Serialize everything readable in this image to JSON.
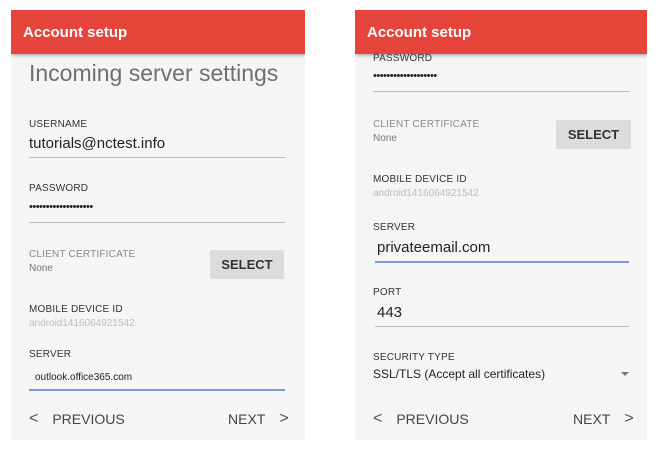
{
  "left": {
    "app_title": "Account setup",
    "heading": "Incoming server settings",
    "username": {
      "label": "USERNAME",
      "value": "tutorials@nctest.info"
    },
    "password": {
      "label": "PASSWORD",
      "value": "•••••••••••••••••••"
    },
    "client_certificate": {
      "label": "CLIENT CERTIFICATE",
      "value": "None",
      "button": "SELECT"
    },
    "mobile_device_id": {
      "label": "MOBILE DEVICE ID",
      "value": "android1416064921542"
    },
    "server": {
      "label": "SERVER",
      "value": "outlook.office365.com"
    },
    "footer": {
      "prev_chev": "<",
      "previous": "PREVIOUS",
      "next": "NEXT",
      "next_chev": ">"
    }
  },
  "right": {
    "app_title": "Account setup",
    "password": {
      "label": "PASSWORD",
      "value": "•••••••••••••••••••"
    },
    "client_certificate": {
      "label": "CLIENT CERTIFICATE",
      "value": "None",
      "button": "SELECT"
    },
    "mobile_device_id": {
      "label": "MOBILE DEVICE ID",
      "value": "android1416064921542"
    },
    "server": {
      "label": "SERVER",
      "value": "privateemail.com"
    },
    "port": {
      "label": "PORT",
      "value": "443"
    },
    "security_type": {
      "label": "SECURITY TYPE",
      "value": "SSL/TLS (Accept all certificates)"
    },
    "footer": {
      "prev_chev": "<",
      "previous": "PREVIOUS",
      "next": "NEXT",
      "next_chev": ">"
    }
  },
  "colors": {
    "app_bar": "#e5443b",
    "active_underline": "#7a9ad6",
    "background": "#f5f5f5"
  },
  "icons": {
    "previous": "chevron-left-icon",
    "next": "chevron-right-icon",
    "dropdown": "dropdown-arrow-icon"
  }
}
